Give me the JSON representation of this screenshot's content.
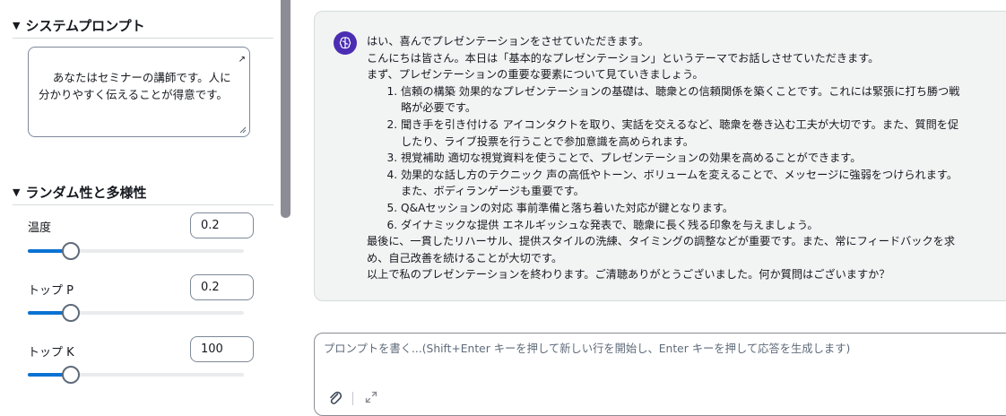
{
  "settings": {
    "system_prompt": {
      "title": "システムプロンプト",
      "value": "あなたはセミナーの講師です。人に分かりやすく伝えることが得意です。"
    },
    "randomness": {
      "title": "ランダム性と多様性",
      "params": [
        {
          "label": "温度",
          "value": "0.2",
          "slider_fraction": 0.2
        },
        {
          "label": "トップ P",
          "value": "0.2",
          "slider_fraction": 0.2
        },
        {
          "label": "トップ K",
          "value": "100",
          "slider_fraction": 0.2
        }
      ]
    }
  },
  "chat": {
    "message": {
      "intro": [
        "はい、喜んでプレゼンテーションをさせていただきます。",
        "こんにちは皆さん。本日は「基本的なプレゼンテーション」というテーマでお話しさせていただきます。",
        "まず、プレゼンテーションの重要な要素について見ていきましょう。"
      ],
      "items": [
        "信頼の構築 効果的なプレゼンテーションの基礎は、聴衆との信頼関係を築くことです。これには緊張に打ち勝つ戦略が必要です。",
        "聞き手を引き付ける アイコンタクトを取り、実話を交えるなど、聴衆を巻き込む工夫が大切です。また、質問を促したり、ライブ投票を行うことで参加意識を高められます。",
        "視覚補助 適切な視覚資料を使うことで、プレゼンテーションの効果を高めることができます。",
        "効果的な話し方のテクニック 声の高低やトーン、ボリュームを変えることで、メッセージに強弱をつけられます。また、ボディランゲージも重要です。",
        "Q&Aセッションの対応 事前準備と落ち着いた対応が鍵となります。",
        "ダイナミックな提供 エネルギッシュな発表で、聴衆に長く残る印象を与えましょう。"
      ],
      "outro": [
        "最後に、一貫したリハーサル、提供スタイルの洗練、タイミングの調整などが重要です。また、常にフィードバックを求め、自己改善を続けることが大切です。",
        "以上で私のプレゼンテーションを終わります。ご清聴ありがとうございました。何か質問はございますか？"
      ]
    },
    "prompt": {
      "placeholder": "プロンプトを書く...(Shift+Enter キーを押して新しい行を開始し、Enter キーを押して応答を生成します)"
    }
  },
  "icons": {
    "avatar": "brain-icon",
    "attach": "paperclip-icon",
    "expand": "expand-icon",
    "collapse": "caret-down-icon"
  },
  "colors": {
    "accent": "#0972d3",
    "avatar_bg": "#4b2db3",
    "card_bg": "#f2f3f3"
  }
}
